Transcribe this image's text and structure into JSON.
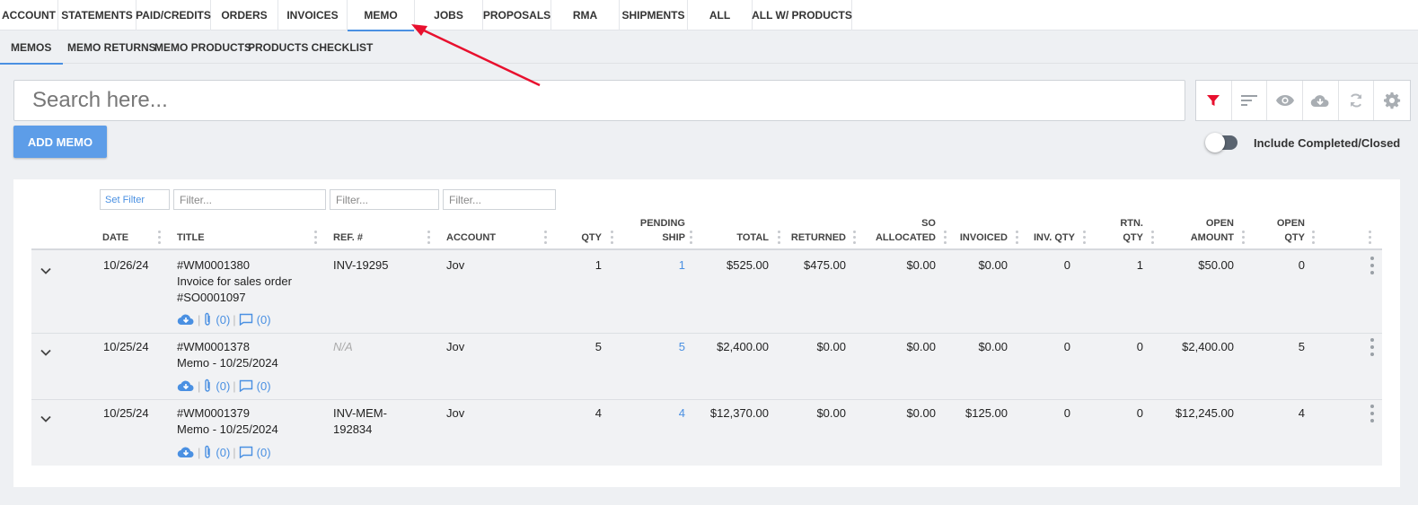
{
  "top_tabs": [
    "ACCOUNT",
    "STATEMENTS",
    "PAID/CREDITS",
    "ORDERS",
    "INVOICES",
    "MEMO",
    "JOBS",
    "PROPOSALS",
    "RMA",
    "SHIPMENTS",
    "ALL",
    "ALL W/ PRODUCTS"
  ],
  "active_top_tab": "MEMO",
  "sub_tabs": [
    "MEMOS",
    "MEMO RETURNS",
    "MEMO PRODUCTS",
    "PRODUCTS CHECKLIST"
  ],
  "active_sub_tab": "MEMOS",
  "search": {
    "placeholder": "Search here..."
  },
  "toolbar": {
    "icons": [
      "filter-icon",
      "sort-icon",
      "eye-icon",
      "cloud-download-icon",
      "refresh-icon",
      "gear-icon"
    ],
    "filter_color": "#e8102e"
  },
  "add_button": "ADD MEMO",
  "include_toggle": {
    "label": "Include Completed/Closed",
    "on": false
  },
  "filters": {
    "set_filter": "Set Filter",
    "placeholder": "Filter..."
  },
  "columns": {
    "date": "DATE",
    "title": "TITLE",
    "ref": "REF. #",
    "account": "ACCOUNT",
    "qty": "QTY",
    "pending_1": "PENDING",
    "pending_2": "SHIP",
    "total": "TOTAL",
    "returned": "RETURNED",
    "so_1": "SO",
    "so_2": "ALLOCATED",
    "invoiced": "INVOICED",
    "inv_qty": "INV. QTY",
    "rtn_1": "RTN.",
    "rtn_2": "QTY",
    "open_amt_1": "OPEN",
    "open_amt_2": "AMOUNT",
    "open_qty_1": "OPEN",
    "open_qty_2": "QTY"
  },
  "rows": [
    {
      "date": "10/26/24",
      "title": [
        "#WM0001380",
        "Invoice for sales order",
        "#SO0001097"
      ],
      "ref": [
        "INV-19295"
      ],
      "ref_na": false,
      "account": "Jov",
      "qty": "1",
      "pending_ship": "1",
      "total": "$525.00",
      "returned": "$475.00",
      "so_allocated": "$0.00",
      "invoiced": "$0.00",
      "inv_qty": "0",
      "rtn_qty": "1",
      "open_amount": "$50.00",
      "open_qty": "0",
      "attachments": "(0)",
      "comments": "(0)"
    },
    {
      "date": "10/25/24",
      "title": [
        "#WM0001378",
        "Memo - 10/25/2024"
      ],
      "ref": [
        "N/A"
      ],
      "ref_na": true,
      "account": "Jov",
      "qty": "5",
      "pending_ship": "5",
      "total": "$2,400.00",
      "returned": "$0.00",
      "so_allocated": "$0.00",
      "invoiced": "$0.00",
      "inv_qty": "0",
      "rtn_qty": "0",
      "open_amount": "$2,400.00",
      "open_qty": "5",
      "attachments": "(0)",
      "comments": "(0)"
    },
    {
      "date": "10/25/24",
      "title": [
        "#WM0001379",
        "Memo - 10/25/2024"
      ],
      "ref": [
        "INV-MEM-",
        "192834"
      ],
      "ref_na": false,
      "account": "Jov",
      "qty": "4",
      "pending_ship": "4",
      "total": "$12,370.00",
      "returned": "$0.00",
      "so_allocated": "$0.00",
      "invoiced": "$125.00",
      "inv_qty": "0",
      "rtn_qty": "0",
      "open_amount": "$12,245.00",
      "open_qty": "4",
      "attachments": "(0)",
      "comments": "(0)"
    }
  ],
  "colors": {
    "accent": "#4a90e2",
    "annotation_arrow": "#e8102e"
  }
}
